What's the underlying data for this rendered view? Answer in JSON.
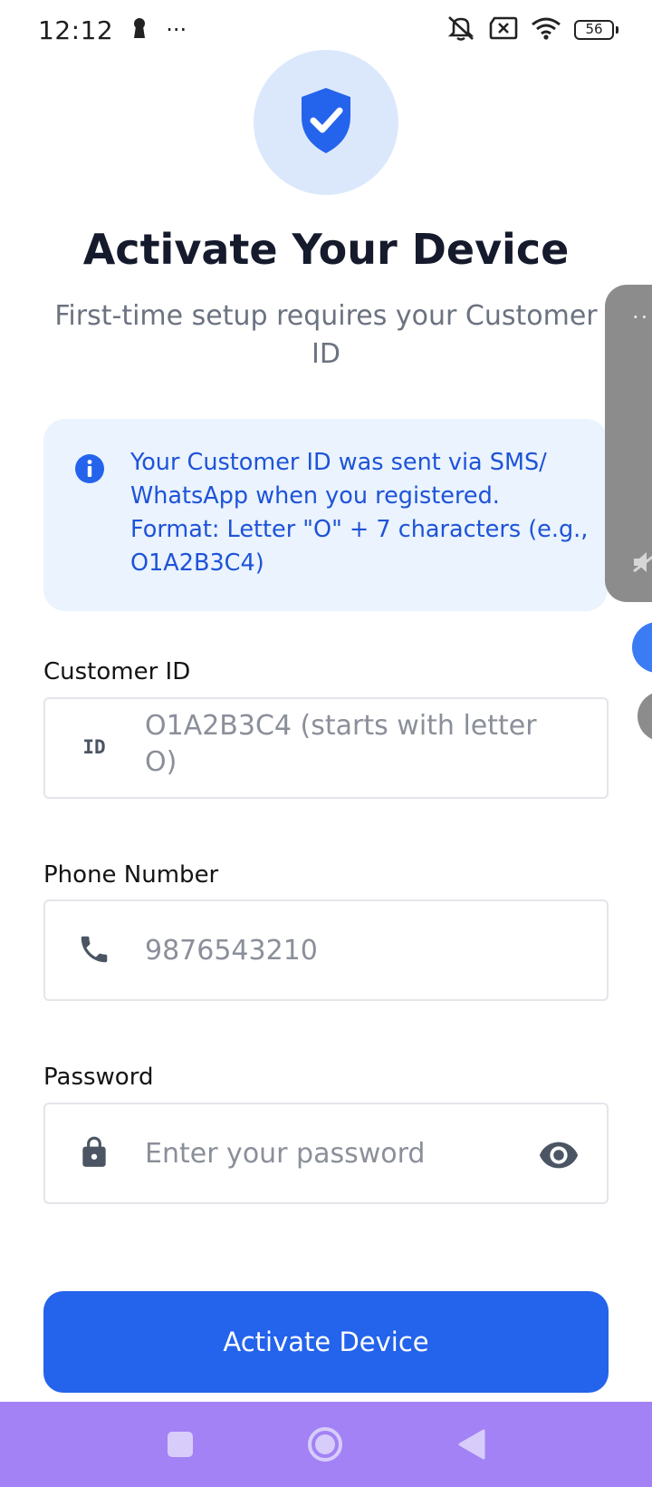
{
  "status_bar": {
    "time": "12:12",
    "more": "···",
    "battery": "56",
    "icons": [
      "keyhole-icon",
      "mute-icon",
      "sim-off-icon",
      "wifi-icon",
      "battery-icon"
    ]
  },
  "hero": {
    "icon": "shield-check-icon"
  },
  "header": {
    "title": "Activate Your Device",
    "subtitle": "First-time setup requires your Customer ID"
  },
  "info_box": {
    "icon": "info-icon",
    "text": "Your Customer ID was sent via SMS/ WhatsApp when you registered. Format: Letter \"O\" + 7 characters (e.g., O1A2B3C4)"
  },
  "form": {
    "customer_id": {
      "label": "Customer ID",
      "icon_text": "ID",
      "placeholder": "O1A2B3C4 (starts with letter O)",
      "value": ""
    },
    "phone": {
      "label": "Phone Number",
      "icon": "phone-icon",
      "placeholder": "9876543210",
      "value": ""
    },
    "password": {
      "label": "Password",
      "icon": "lock-icon",
      "placeholder": "Enter your password",
      "value": "",
      "toggle_icon": "eye-icon"
    },
    "submit_label": "Activate Device"
  },
  "side_panel": {
    "dots": "··"
  },
  "nav_bar": {
    "buttons": [
      "recents-button",
      "home-button",
      "back-button"
    ]
  },
  "colors": {
    "accent": "#2463eb",
    "info_bg": "#eaf3fe",
    "info_text": "#1e53d8",
    "hero_bg": "#dbe8fc",
    "nav_bar": "#a282f4",
    "title": "#151a2c",
    "subtitle": "#6b7280"
  }
}
